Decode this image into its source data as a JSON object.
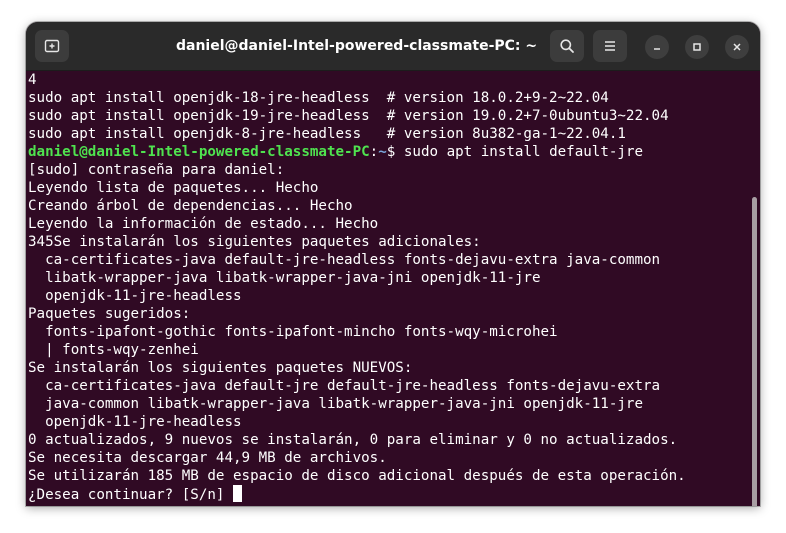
{
  "window": {
    "title": "daniel@daniel-Intel-powered-classmate-PC: ~"
  },
  "icons": {
    "new_tab": "new-tab-icon",
    "search": "search-icon",
    "menu": "hamburger-menu-icon",
    "minimize": "minimize-icon",
    "maximize": "maximize-icon",
    "close": "close-icon"
  },
  "colors": {
    "terminal_background": "#300a24",
    "titlebar_background": "#2a2a2a",
    "prompt_user": "#4fe34f",
    "prompt_path": "#7aa6da",
    "text": "#ffffff"
  },
  "terminal": {
    "lines": [
      "4",
      "sudo apt install openjdk-18-jre-headless  # version 18.0.2+9-2~22.04",
      "sudo apt install openjdk-19-jre-headless  # version 19.0.2+7-0ubuntu3~22.04",
      "sudo apt install openjdk-8-jre-headless   # version 8u382-ga-1~22.04.1"
    ],
    "prompt": {
      "user_host": "daniel@daniel-Intel-powered-classmate-PC",
      "separator": ":",
      "path": "~",
      "symbol": "$ ",
      "command": "sudo apt install default-jre"
    },
    "output": [
      "[sudo] contraseña para daniel:",
      "Leyendo lista de paquetes... Hecho",
      "Creando árbol de dependencias... Hecho",
      "Leyendo la información de estado... Hecho",
      "345Se instalarán los siguientes paquetes adicionales:",
      "  ca-certificates-java default-jre-headless fonts-dejavu-extra java-common",
      "  libatk-wrapper-java libatk-wrapper-java-jni openjdk-11-jre",
      "  openjdk-11-jre-headless",
      "Paquetes sugeridos:",
      "  fonts-ipafont-gothic fonts-ipafont-mincho fonts-wqy-microhei",
      "  | fonts-wqy-zenhei",
      "Se instalarán los siguientes paquetes NUEVOS:",
      "  ca-certificates-java default-jre default-jre-headless fonts-dejavu-extra",
      "  java-common libatk-wrapper-java libatk-wrapper-java-jni openjdk-11-jre",
      "  openjdk-11-jre-headless",
      "0 actualizados, 9 nuevos se instalarán, 0 para eliminar y 0 no actualizados.",
      "Se necesita descargar 44,9 MB de archivos.",
      "Se utilizarán 185 MB de espacio de disco adicional después de esta operación."
    ],
    "final_prompt": "¿Desea continuar? [S/n] "
  }
}
